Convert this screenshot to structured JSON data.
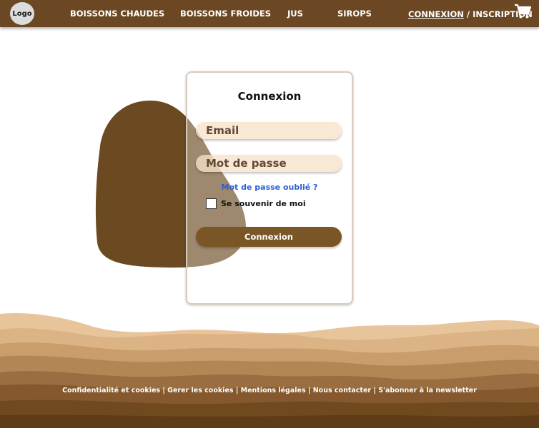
{
  "nav": {
    "logo": "Logo",
    "links": [
      "BOISSONS CHAUDES",
      "BOISSONS FROIDES",
      "JUS",
      "SIROPS"
    ],
    "login": "CONNEXION",
    "separator": " / ",
    "signup": "INSCRIPTION",
    "cart_icon": "shopping-cart-icon"
  },
  "login_card": {
    "title": "Connexion",
    "email_placeholder": "Email",
    "password_placeholder": "Mot de passe",
    "forgot_password": "Mot de passe oublié ?",
    "remember_me": "Se souvenir de moi",
    "submit": "Connexion"
  },
  "footer": {
    "links": [
      "Confidentialité et cookies",
      "Gerer les cookies",
      "Mentions légales",
      "Nous contacter",
      "S'abonner à la newsletter"
    ],
    "separator": " | "
  },
  "colors": {
    "navbar": "#6b4823",
    "button": "#7a5626",
    "input_background": "#f6e1c8",
    "link": "#2f5fd0",
    "blob": "#6b4a22"
  }
}
